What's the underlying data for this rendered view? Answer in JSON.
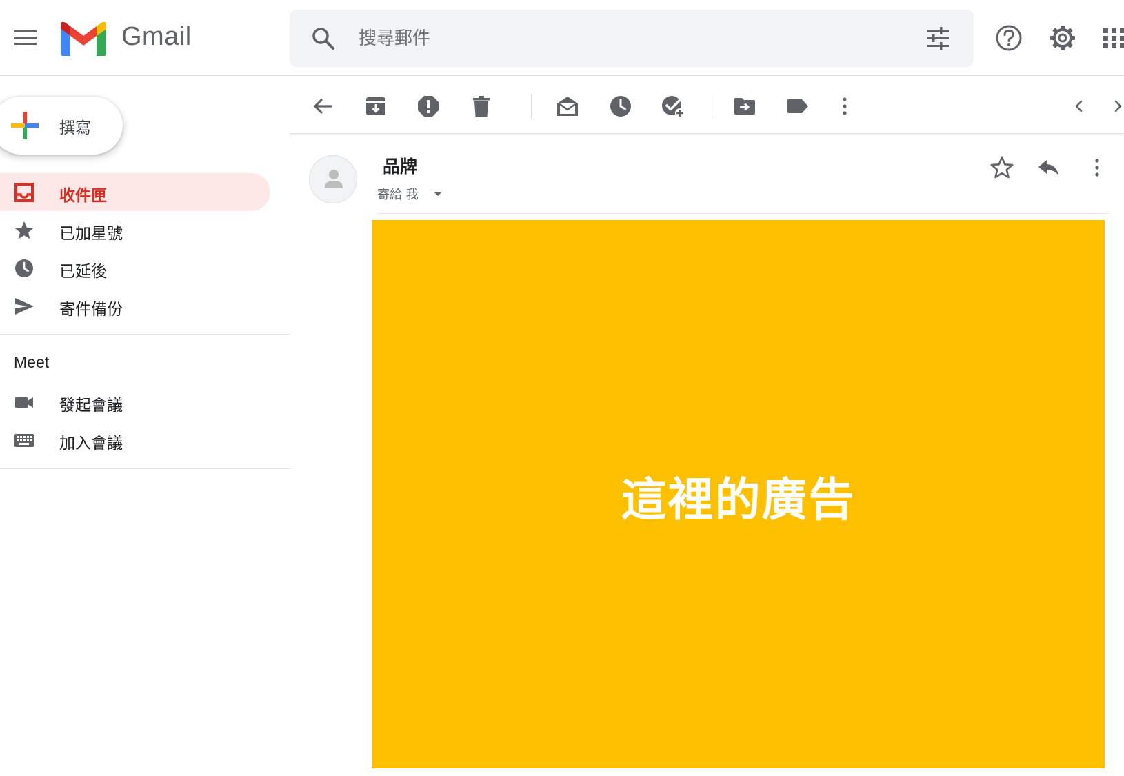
{
  "app": {
    "name": "Gmail"
  },
  "search": {
    "placeholder": "搜尋郵件"
  },
  "compose": {
    "label": "撰寫"
  },
  "sidebar": {
    "items": [
      {
        "label": "收件匣",
        "icon": "inbox-icon",
        "active": true
      },
      {
        "label": "已加星號",
        "icon": "star-icon"
      },
      {
        "label": "已延後",
        "icon": "clock-icon"
      },
      {
        "label": "寄件備份",
        "icon": "send-icon"
      }
    ]
  },
  "meet": {
    "title": "Meet",
    "items": [
      {
        "label": "發起會議",
        "icon": "videocam-icon"
      },
      {
        "label": "加入會議",
        "icon": "keyboard-icon"
      }
    ]
  },
  "message": {
    "sender": "品牌",
    "recipient": "寄給 我",
    "ad_text": "這裡的廣告"
  },
  "colors": {
    "accent_red": "#d93025",
    "active_bg": "#fce8e6",
    "ad_bg": "#fdc000",
    "icon_gray": "#5f6368"
  }
}
